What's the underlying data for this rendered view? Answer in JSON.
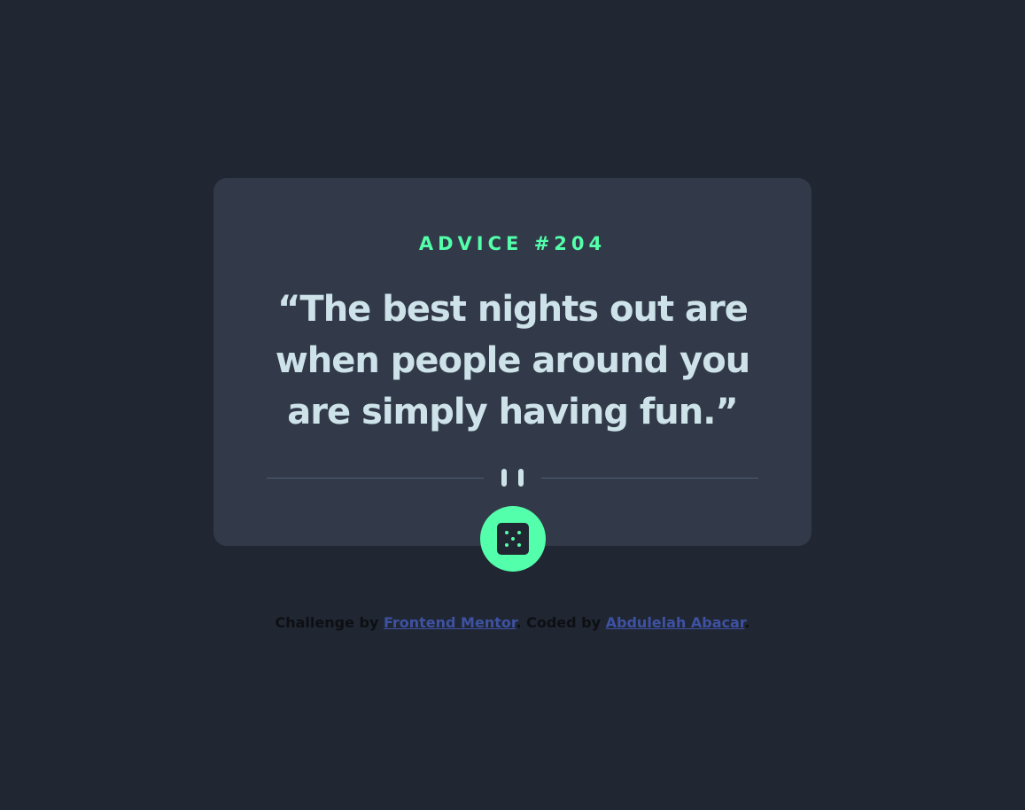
{
  "card": {
    "advice_label": "ADVICE #204",
    "quote": "“The best nights out are when people around you are simply having fun.”"
  },
  "divider": {
    "icon": "pause-icon"
  },
  "dice_button": {
    "icon": "dice-icon"
  },
  "footer": {
    "challenge_prefix": "Challenge by ",
    "challenge_link": "Frontend Mentor",
    "coded_prefix": ". Coded by ",
    "coded_link": "Abdulelah Abacar",
    "suffix": "."
  },
  "colors": {
    "background": "#202632",
    "card": "#323a49",
    "accent": "#53ffaa",
    "quote_text": "#cee3e9",
    "link": "#3e52a3"
  }
}
